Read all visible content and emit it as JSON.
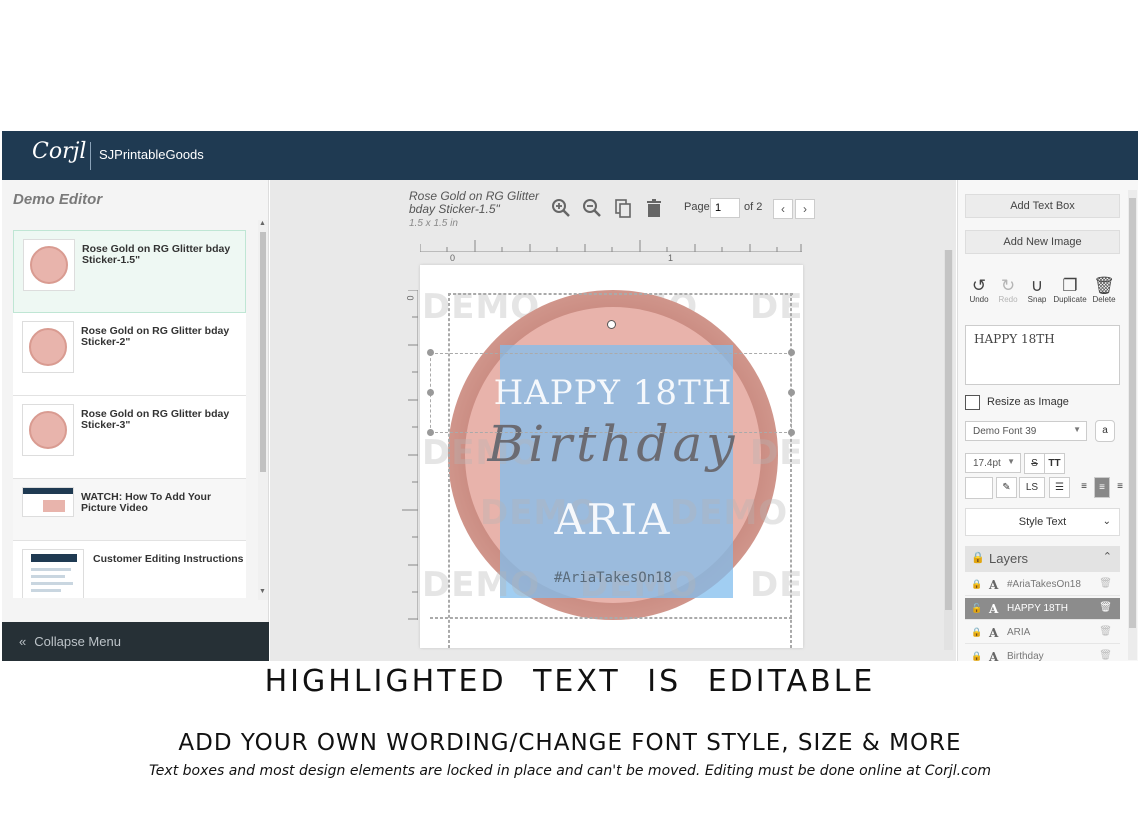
{
  "header": {
    "logo_text": "Corjl",
    "shop_name": "SJPrintableGoods"
  },
  "left_panel": {
    "title": "Demo Editor",
    "templates": [
      {
        "label": "Rose Gold on RG Glitter bday Sticker-1.5\"",
        "selected": true
      },
      {
        "label": "Rose Gold on RG Glitter bday Sticker-2\"",
        "selected": false
      },
      {
        "label": "Rose Gold on RG Glitter bday Sticker-3\"",
        "selected": false
      },
      {
        "label": "WATCH: How To Add Your Picture Video",
        "selected": false
      },
      {
        "label": "Customer Editing Instructions",
        "selected": false
      }
    ],
    "collapse_label": "Collapse Menu"
  },
  "canvas": {
    "doc_title": "Rose Gold on RG Glitter bday Sticker-1.5\"",
    "doc_size": "1.5 x 1.5 in",
    "page_label": "Page",
    "page_value": "1",
    "page_of": "of 2",
    "ruler_top": [
      "0",
      "1"
    ],
    "ruler_left": [
      "0"
    ],
    "watermark": "DEMO",
    "sticker": {
      "line1": "HAPPY 18TH",
      "line2": "Birthday",
      "line3": "ARIA",
      "line4": "#AriaTakesOn18"
    }
  },
  "right_panel": {
    "add_text_box": "Add Text Box",
    "add_new_image": "Add New Image",
    "actions": [
      {
        "label": "Undo",
        "enabled": true
      },
      {
        "label": "Redo",
        "enabled": false
      },
      {
        "label": "Snap",
        "enabled": true
      },
      {
        "label": "Duplicate",
        "enabled": true
      },
      {
        "label": "Delete",
        "enabled": true
      }
    ],
    "text_value": "HAPPY 18TH",
    "resize_as_image": "Resize as Image",
    "font_name": "Demo Font 39",
    "font_size": "17.4pt",
    "style_text": "Style Text",
    "layers_title": "Layers",
    "layers": [
      {
        "name": "#AriaTakesOn18",
        "selected": false
      },
      {
        "name": "HAPPY 18TH",
        "selected": true
      },
      {
        "name": "ARIA",
        "selected": false
      },
      {
        "name": "Birthday",
        "selected": false
      }
    ]
  },
  "captions": {
    "headline": "HIGHLIGHTED TEXT IS EDITABLE",
    "subhead": "ADD YOUR OWN WORDING/CHANGE FONT STYLE, SIZE & MORE",
    "note": "Text boxes and most design elements are locked in place and can't be moved. Editing must be done online at Corjl.com"
  },
  "colors": {
    "header_bg": "#1f3a52",
    "collapse_bg": "#263036",
    "rose_gold": "#e8b3ab",
    "highlight_blue": "#82beee"
  }
}
